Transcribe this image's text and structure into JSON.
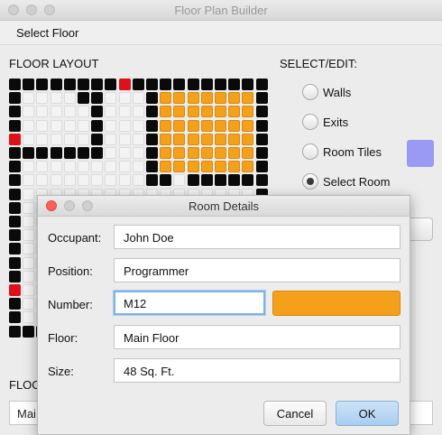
{
  "window": {
    "title": "Floor Plan Builder"
  },
  "menu": {
    "select_floor": "Select Floor"
  },
  "floor_layout": {
    "label": "FLOOR LAYOUT",
    "bottom_label": "FLOO",
    "bottom_field_value": "Mai",
    "grid_rows": [
      "BBBBBBBBRBBBBBBBBBB",
      "BWWWWBBWWWBOOOOOOOB",
      "BWWWWWBWWWBOOOOOOOB",
      "BWWWWWBWWWBOOOOOOOB",
      "RWWWWWBWWWBOOOOOOOB",
      "BBBBBBBWWWBOOOOOOOB",
      "BWWWWWWWWWBOOOOOOOB",
      "BWWWWWWWWWBBWBBBBBB",
      "BWWWWWWWWWWWWWWWWWB",
      "BWWWWWWWWWWWWWWWWWB",
      "BWWWWWWWWWWWWWWWWWB",
      "BWWWWWWWWWWWWWWWWWB",
      "BWWWWWWWWWWWWWWWWWB",
      "BWWWWWWWWWWWWWWWWWB",
      "BWWWWWWWWWWWWWWWWWB",
      "RWWWWWWWWWWWWWWWWWB",
      "BWWWWWWWWWWWWWWWWWB",
      "BWWWWWWWWWWWWWWWWWB",
      "BBBBBBBBBBBBBBBBBBB"
    ]
  },
  "select_edit": {
    "label": "SELECT/EDIT:",
    "options": [
      {
        "label": "Walls",
        "selected": false
      },
      {
        "label": "Exits",
        "selected": false
      },
      {
        "label": "Room Tiles",
        "selected": false
      },
      {
        "label": "Select Room",
        "selected": true
      }
    ],
    "tile_color": "#9a9af5"
  },
  "colors": {
    "wall": "#0a0a0a",
    "exit": "#e0101a",
    "floor": "#f3f3f3",
    "room": "#f5a01a"
  },
  "room_dialog": {
    "title": "Room Details",
    "occupant_label": "Occupant:",
    "occupant_value": "John Doe",
    "position_label": "Position:",
    "position_value": "Programmer",
    "number_label": "Number:",
    "number_value": "M12",
    "room_color": "#f5a01a",
    "floor_label": "Floor:",
    "floor_value": "Main Floor",
    "size_label": "Size:",
    "size_value": "48 Sq. Ft.",
    "cancel_label": "Cancel",
    "ok_label": "OK"
  }
}
